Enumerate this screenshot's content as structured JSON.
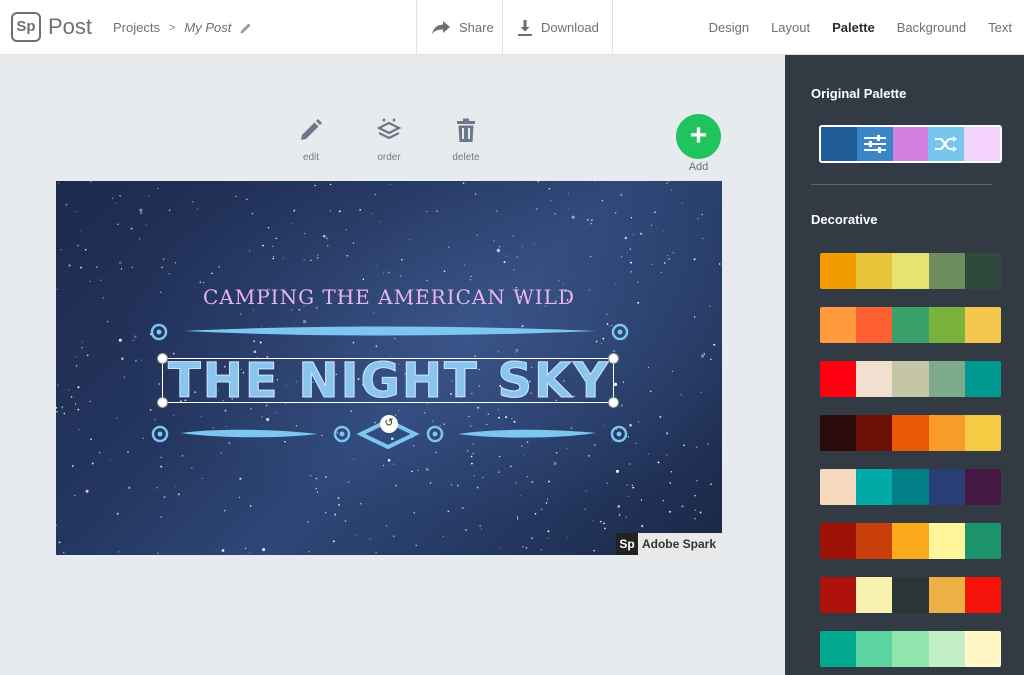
{
  "app": {
    "logo_text": "Sp",
    "name": "Post"
  },
  "breadcrumb": {
    "root": "Projects",
    "separator": ">",
    "current": "My Post"
  },
  "actions": {
    "share": "Share",
    "download": "Download"
  },
  "nav": {
    "items": [
      "Design",
      "Layout",
      "Palette",
      "Background",
      "Text"
    ],
    "active": "Palette"
  },
  "tools": {
    "edit": "edit",
    "order": "order",
    "delete": "delete",
    "add": "Add",
    "add_symbol": "+"
  },
  "canvas": {
    "subtitle": "CAMPING THE AMERICAN WILD",
    "headline": "THE NIGHT SKY",
    "rotate_icon": "↺",
    "watermark_logo": "Sp",
    "watermark_text": "Adobe Spark",
    "colors": {
      "subtitle": "#e8b5ee",
      "headline": "#8ac4ef",
      "ornament": "#7cc6f2"
    }
  },
  "panel": {
    "original_title": "Original Palette",
    "original_palette": [
      "#1f5b95",
      "#3b86c6",
      "#d281df",
      "#78c6ee",
      "#f2d3fb"
    ],
    "original_icons": [
      "sliders-icon",
      "shuffle-icon"
    ],
    "decorative_title": "Decorative",
    "palettes": [
      [
        "#f39c00",
        "#e8c43a",
        "#e5e472",
        "#6e8d5e",
        "#2f4a3c"
      ],
      [
        "#ff9b3d",
        "#fe5f33",
        "#3ba06a",
        "#79b33e",
        "#f4c84f"
      ],
      [
        "#ff0011",
        "#f2dfd0",
        "#c4c6a6",
        "#7eab8b",
        "#009890"
      ],
      [
        "#2c0a0a",
        "#6b1004",
        "#e85a07",
        "#f99b28",
        "#f6cb44"
      ],
      [
        "#f7d9c0",
        "#00aaa6",
        "#007f86",
        "#283e75",
        "#451844"
      ],
      [
        "#9e1208",
        "#c73e0b",
        "#fbaa1c",
        "#fff69c",
        "#1c936a"
      ],
      [
        "#ad130c",
        "#f8f1b0",
        "#2b3535",
        "#ecb044",
        "#f51309"
      ],
      [
        "#02a98e",
        "#5cd4a1",
        "#90e6ac",
        "#c2efc6",
        "#fff8c6"
      ]
    ]
  }
}
